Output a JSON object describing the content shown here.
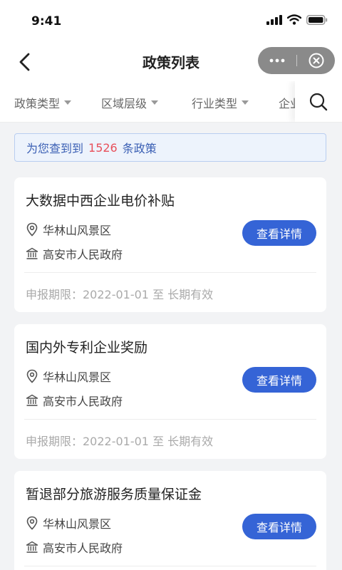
{
  "status": {
    "time": "9:41"
  },
  "nav": {
    "title": "政策列表",
    "more": "···"
  },
  "filters": [
    {
      "label": "政策类型"
    },
    {
      "label": "区域层级"
    },
    {
      "label": "行业类型"
    },
    {
      "label": "企业"
    }
  ],
  "result": {
    "prefix": "为您查到到",
    "count": "1526",
    "suffix": "条政策"
  },
  "cards": [
    {
      "title": "大数据中西企业电价补贴",
      "region": "华林山风景区",
      "org": "高安市人民政府",
      "button": "查看详情",
      "period": "申报期限：2022-01-01  至  长期有效"
    },
    {
      "title": "国内外专利企业奖励",
      "region": "华林山风景区",
      "org": "高安市人民政府",
      "button": "查看详情",
      "period": "申报期限：2022-01-01  至  长期有效"
    },
    {
      "title": "暂退部分旅游服务质量保证金",
      "region": "华林山风景区",
      "org": "高安市人民政府",
      "button": "查看详情"
    }
  ],
  "colors": {
    "accent": "#3564d6",
    "count": "#e8505b",
    "result_bg": "#edf3fc"
  },
  "icons": [
    "signal-icon",
    "wifi-icon",
    "battery-icon",
    "back-arrow-icon",
    "more-icon",
    "close-circle-icon",
    "caret-down-icon",
    "search-icon",
    "location-pin-icon",
    "government-building-icon"
  ]
}
